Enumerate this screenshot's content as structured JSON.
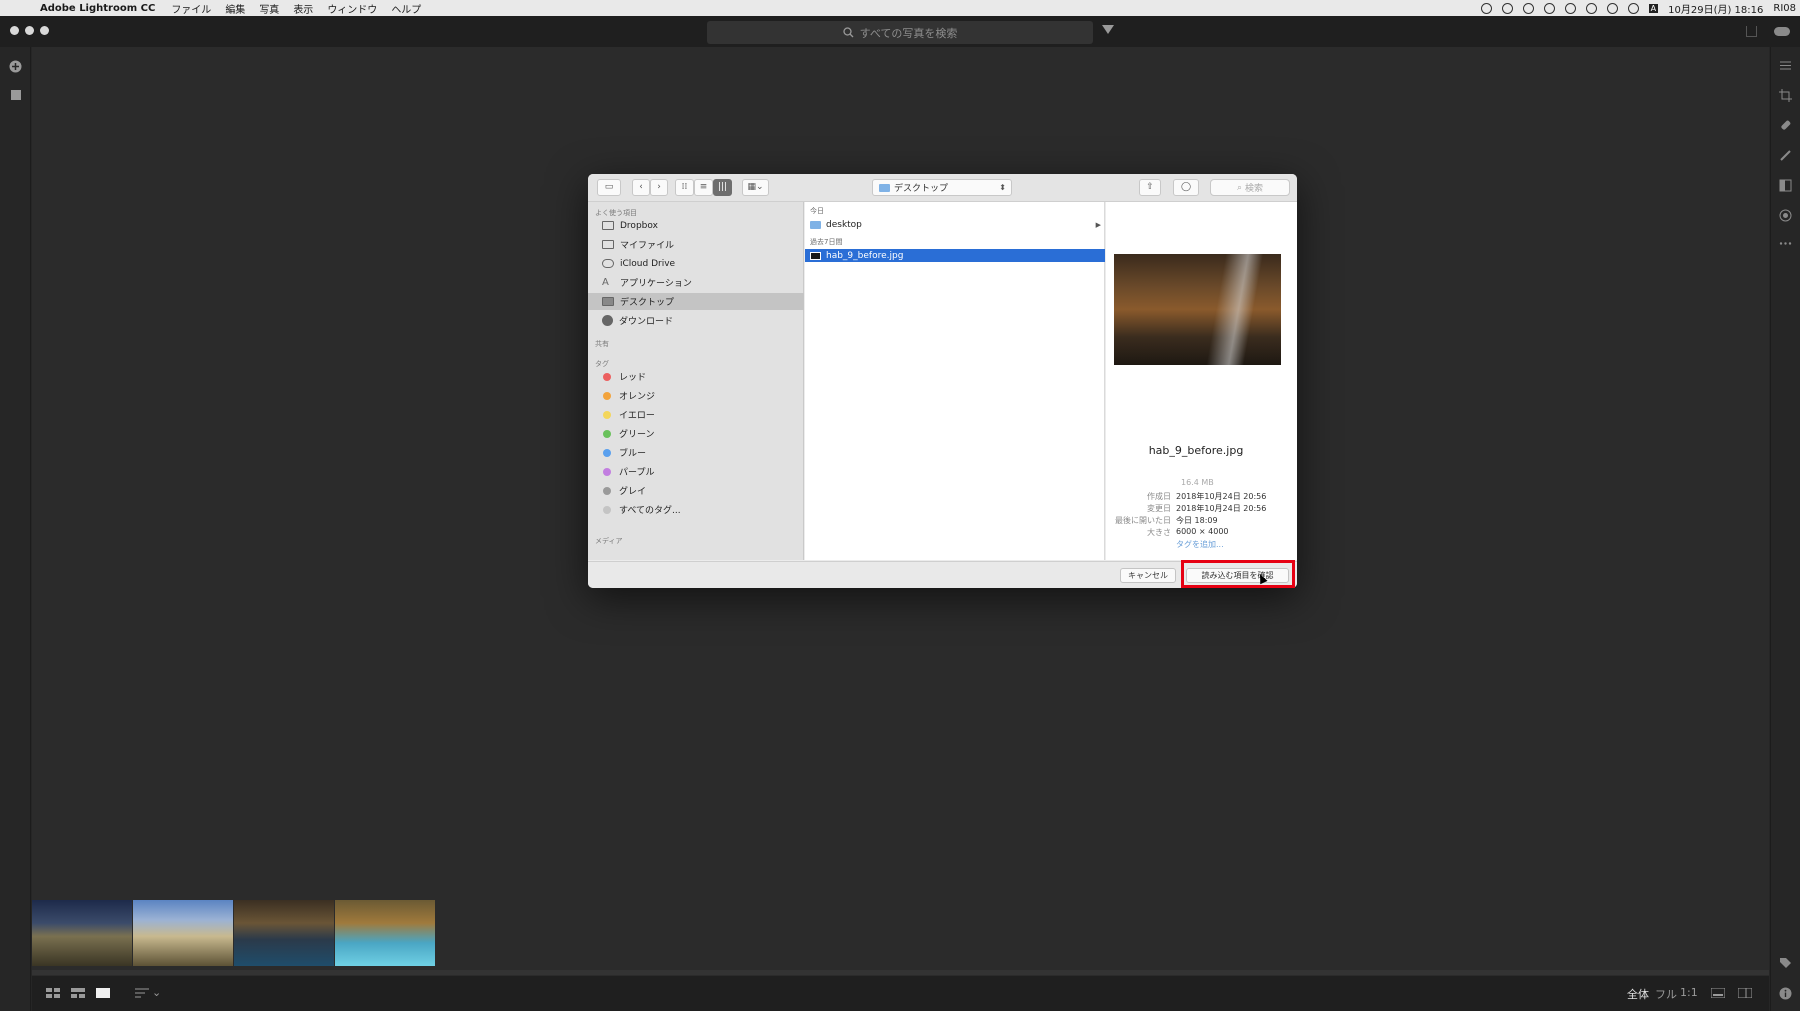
{
  "menubar": {
    "app_name": "Adobe Lightroom CC",
    "items": [
      "ファイル",
      "編集",
      "写真",
      "表示",
      "ウィンドウ",
      "ヘルプ"
    ],
    "clock": "10月29日(月)  18:16",
    "user": "RI08",
    "input_indicator": "A"
  },
  "app": {
    "search_placeholder": "すべての写真を検索"
  },
  "dialog": {
    "location": "デスクトップ",
    "search_placeholder": "検索",
    "sidebar": {
      "favorites_header": "よく使う項目",
      "favorites": [
        "Dropbox",
        "マイファイル",
        "iCloud Drive",
        "アプリケーション",
        "デスクトップ",
        "ダウンロード"
      ],
      "shared_header": "共有",
      "tags_header": "タグ",
      "tags": [
        {
          "label": "レッド",
          "color": "#ec5f5f"
        },
        {
          "label": "オレンジ",
          "color": "#f2a33c"
        },
        {
          "label": "イエロー",
          "color": "#f3d65b"
        },
        {
          "label": "グリーン",
          "color": "#69c15b"
        },
        {
          "label": "ブルー",
          "color": "#5aa0ee"
        },
        {
          "label": "パープル",
          "color": "#c27ee0"
        },
        {
          "label": "グレイ",
          "color": "#9a9a9a"
        }
      ],
      "all_tags": "すべてのタグ...",
      "media_header": "メディア"
    },
    "files": {
      "today_header": "今日",
      "today_items": [
        "desktop"
      ],
      "week_header": "過去7日間",
      "week_items": [
        "hab_9_before.jpg"
      ]
    },
    "preview": {
      "filename": "hab_9_before.jpg",
      "size": "16.4 MB",
      "meta": [
        {
          "key": "作成日",
          "value": "2018年10月24日 20:56"
        },
        {
          "key": "変更日",
          "value": "2018年10月24日 20:56"
        },
        {
          "key": "最後に開いた日",
          "value": "今日 18:09"
        },
        {
          "key": "大きさ",
          "value": "6000 × 4000"
        }
      ],
      "add_tags": "タグを追加..."
    },
    "buttons": {
      "cancel": "キャンセル",
      "confirm": "読み込む項目を確認"
    }
  },
  "bottom": {
    "zoom_all": "全体",
    "zoom_full": "フル",
    "zoom_1to1": "1:1"
  },
  "colors": {
    "highlight": "#e60012",
    "selection": "#2a6ed6"
  }
}
